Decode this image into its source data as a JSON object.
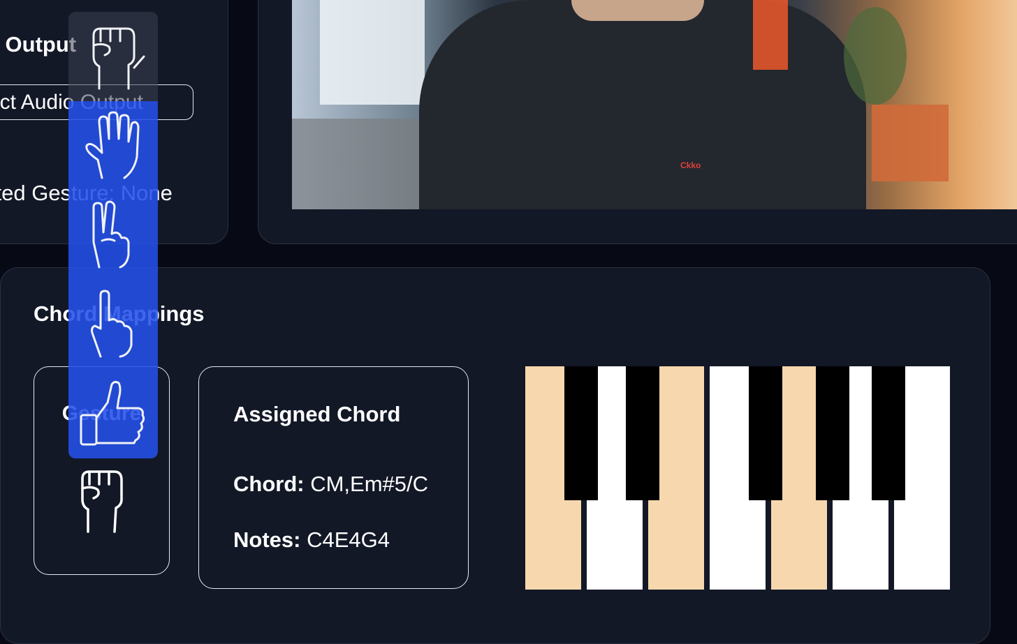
{
  "controls": {
    "audio_output_title": "o Output",
    "select_audio_label": "ect Audio Output",
    "detected_gesture_label": "cted Gesture: None"
  },
  "chord_mappings": {
    "title": "Chord Mappings",
    "gesture_card_label": "Gesture",
    "gesture_icon": "closed-fist-icon",
    "assigned_chord_title": "Assigned Chord",
    "chord_key": "Chord:",
    "chord_value": "CM,Em#5/C",
    "notes_key": "Notes:",
    "notes_value": "C4E4G4"
  },
  "camera": {
    "shirt_text": "Ckko"
  },
  "gesture_picker": {
    "items": [
      "closed-fist-icon",
      "open-palm-icon",
      "victory-icon",
      "pointing-up-icon",
      "thumbs-up-icon"
    ],
    "selected": "closed-fist-icon"
  },
  "piano": {
    "active_keys": [
      "C4",
      "E4",
      "G4"
    ],
    "colors": {
      "active": "#f7d7ad",
      "white": "#ffffff",
      "black": "#000000"
    }
  },
  "colors": {
    "background": "#070a14",
    "panel": "#131827",
    "picker_blue": "#2450eb"
  }
}
